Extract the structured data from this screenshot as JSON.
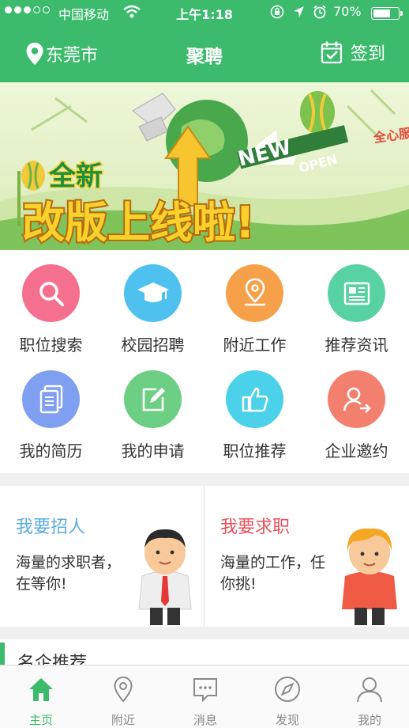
{
  "status_bar": {
    "carrier": "中国移动",
    "time": "上午1:18",
    "battery": "70%",
    "battery_level": 0.7
  },
  "header": {
    "location": "东莞市",
    "title": "聚聘",
    "signin": "签到"
  },
  "banner": {
    "line1": "全新",
    "line2": "改版上线啦!",
    "badge_new": "NEW",
    "badge_open": "OPEN",
    "side_text": "全心服"
  },
  "grid": [
    {
      "label": "职位搜索",
      "icon": "search-icon",
      "color": "#f56f8e"
    },
    {
      "label": "校园招聘",
      "icon": "graduation-cap-icon",
      "color": "#4fc1ef"
    },
    {
      "label": "附近工作",
      "icon": "location-pin-icon",
      "color": "#f7a04a"
    },
    {
      "label": "推荐资讯",
      "icon": "newspaper-icon",
      "color": "#59d2a3"
    },
    {
      "label": "我的简历",
      "icon": "resume-icon",
      "color": "#7f9ff0"
    },
    {
      "label": "我的申请",
      "icon": "edit-icon",
      "color": "#6ccf83"
    },
    {
      "label": "职位推荐",
      "icon": "thumbs-up-icon",
      "color": "#4bd1e9"
    },
    {
      "label": "企业邀约",
      "icon": "user-invite-icon",
      "color": "#f37f6f"
    }
  ],
  "cards": {
    "recruit": {
      "title": "我要招人",
      "desc": "海量的求职者，在等你!",
      "color": "#5aace0"
    },
    "jobseek": {
      "title": "我要求职",
      "desc": "海量的工作，任你挑!",
      "color": "#e8505b"
    }
  },
  "section": {
    "title": "名企推荐"
  },
  "tabs": [
    {
      "label": "主页",
      "icon": "home-icon",
      "active": true
    },
    {
      "label": "附近",
      "icon": "location-pin-icon",
      "active": false
    },
    {
      "label": "消息",
      "icon": "message-icon",
      "active": false
    },
    {
      "label": "发现",
      "icon": "compass-icon",
      "active": false
    },
    {
      "label": "我的",
      "icon": "user-icon",
      "active": false
    }
  ],
  "colors": {
    "brand": "#3cbb6d"
  }
}
